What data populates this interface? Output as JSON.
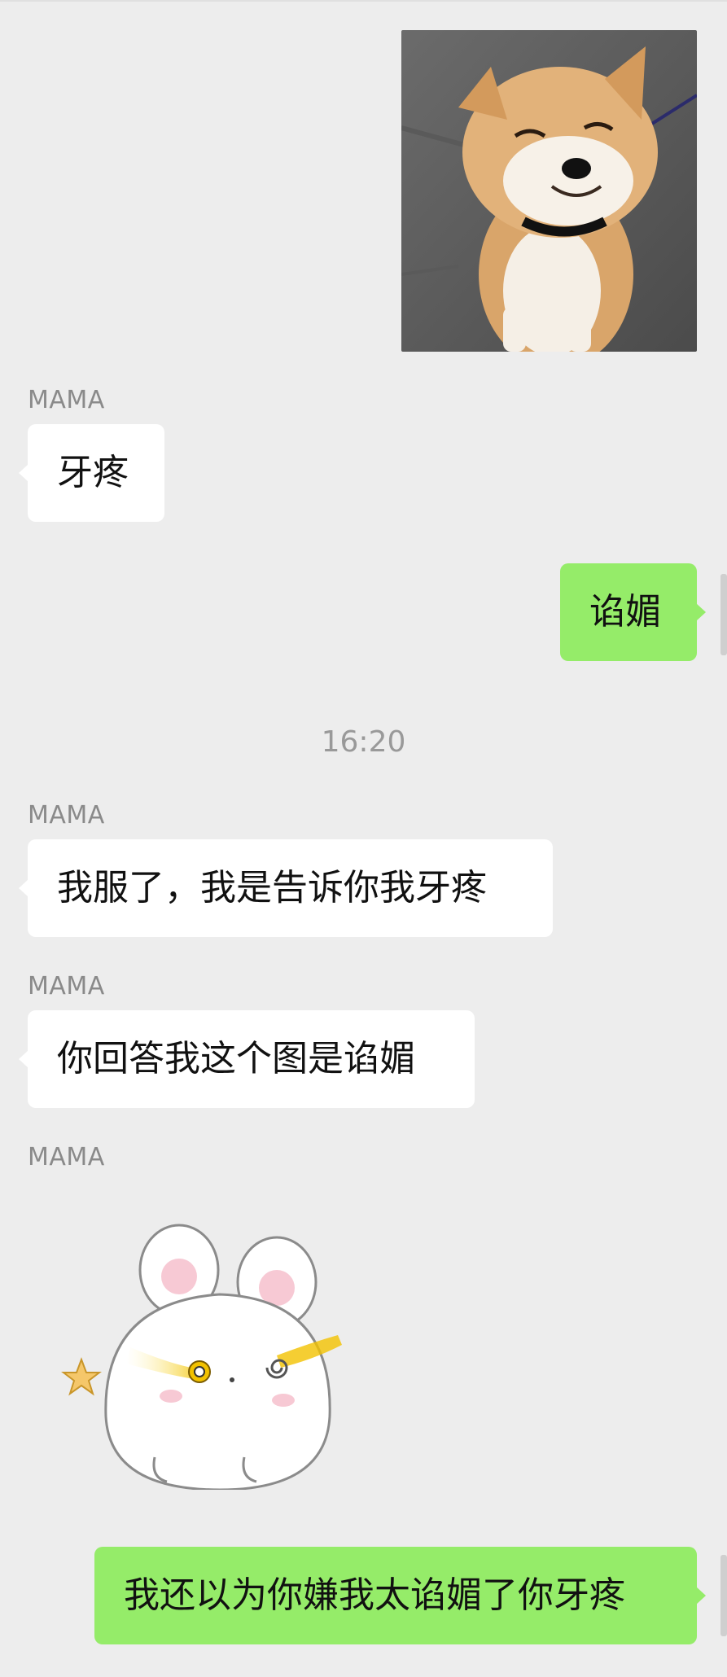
{
  "messages": {
    "m1": {
      "sender": "",
      "type": "image",
      "icon": "shiba-dog-photo"
    },
    "m2": {
      "sender": "MAMA",
      "text": "牙疼"
    },
    "m3": {
      "text": "谄媚"
    },
    "timestamp": "16:20",
    "m4": {
      "sender": "MAMA",
      "text": "我服了，我是告诉你我牙疼"
    },
    "m5": {
      "sender": "MAMA",
      "text": "你回答我这个图是谄媚"
    },
    "m6": {
      "sender": "MAMA",
      "type": "sticker",
      "icon": "rabbit-sticker"
    },
    "m7": {
      "text": "我还以为你嫌我太谄媚了你牙疼"
    }
  },
  "colors": {
    "background": "#ededed",
    "incoming_bubble": "#ffffff",
    "outgoing_bubble": "#95ec69",
    "sender_name": "#8a8a8a",
    "timestamp": "#999999"
  }
}
